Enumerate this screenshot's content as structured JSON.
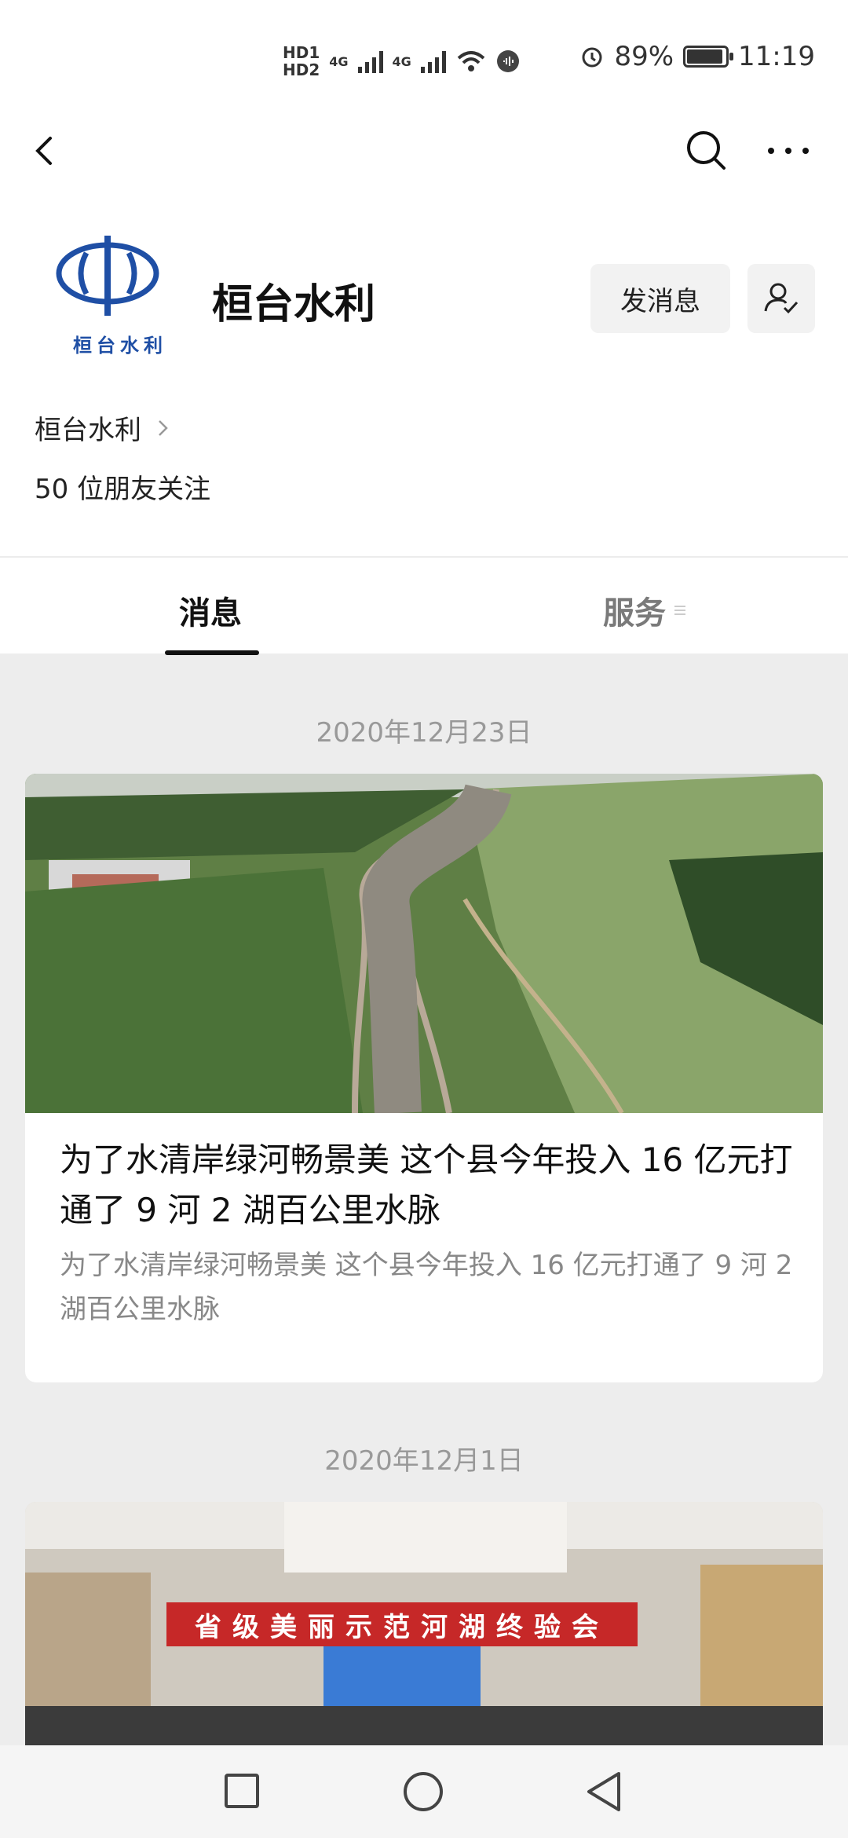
{
  "status_bar": {
    "sim1": "HD1",
    "sim2": "HD2",
    "net1": "4G",
    "net2": "4G",
    "battery_pct": "89%",
    "time": "11:19"
  },
  "account": {
    "name": "桓台水利",
    "logo_text": "桓台水利",
    "message_button": "发消息",
    "sub_account": "桓台水利",
    "followers": "50 位朋友关注"
  },
  "tabs": {
    "messages": "消息",
    "services": "服务"
  },
  "feed": [
    {
      "date": "2020年12月23日",
      "title": "为了水清岸绿河畅景美 这个县今年投入 16 亿元打通了 9 河 2 湖百公里水脉",
      "desc": "为了水清岸绿河畅景美 这个县今年投入 16 亿元打通了 9 河 2 湖百公里水脉"
    },
    {
      "date": "2020年12月1日",
      "banner": "省级美丽示范河湖终验会"
    }
  ],
  "colors": {
    "brand_blue": "#1f4fa5",
    "banner_red": "#c62828"
  }
}
